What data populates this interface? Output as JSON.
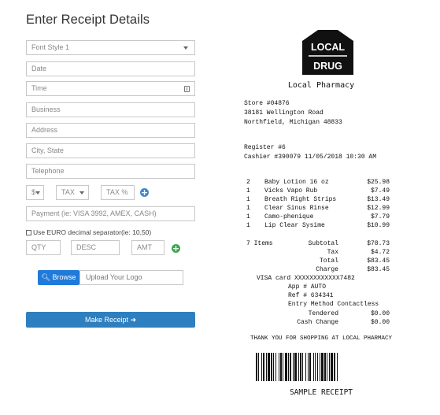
{
  "form": {
    "title": "Enter Receipt Details",
    "font_style": "Font Style 1",
    "date_placeholder": "Date",
    "time_placeholder": "Time",
    "business_placeholder": "Business",
    "address_placeholder": "Address",
    "city_state_placeholder": "City, State",
    "telephone_placeholder": "Telephone",
    "currency": "$",
    "tax_select": "TAX",
    "tax_percent_placeholder": "TAX %",
    "payment_placeholder": "Payment (ie: VISA 3992, AMEX, CASH)",
    "euro_checkbox_label": "Use EURO decimal separator(ie: 10,50)",
    "qty_placeholder": "QTY",
    "desc_placeholder": "DESC",
    "amt_placeholder": "AMT",
    "browse_label": "Browse",
    "upload_placeholder": "Upload Your Logo",
    "make_receipt_label": "Make Receipt"
  },
  "receipt": {
    "logo_lines": [
      "LOCAL",
      "DRUG"
    ],
    "store_name": "Local Pharmacy",
    "header_lines": [
      "Store #04876",
      "38181 Wellington Road",
      "Northfield, Michigan 48833"
    ],
    "register": "Register #6",
    "cashier": "Cashier #390079 11/05/2018 10:30 AM",
    "items": [
      {
        "qty": "2",
        "desc": "Baby Lotion 16 oz",
        "amt": "$25.98"
      },
      {
        "qty": "1",
        "desc": "Vicks Vapo Rub",
        "amt": "$7.49"
      },
      {
        "qty": "1",
        "desc": "Breath Right Strips",
        "amt": "$13.49"
      },
      {
        "qty": "1",
        "desc": "Clear Sinus Rinse",
        "amt": "$12.99"
      },
      {
        "qty": "1",
        "desc": "Camo-phenique",
        "amt": "$7.79"
      },
      {
        "qty": "1",
        "desc": "Lip Clear Sysime",
        "amt": "$10.99"
      }
    ],
    "items_count": "7 Items",
    "subtotal_label": "Subtotal",
    "subtotal": "$78.73",
    "tax_label": "Tax",
    "tax": "$4.72",
    "total_label": "Total",
    "total": "$83.45",
    "charge_label": "Charge",
    "charge": "$83.45",
    "card": "VISA card XXXXXXXXXXXX7482",
    "app": "App # AUTO",
    "ref": "Ref # 634341",
    "entry_method": "Entry Method Contactless",
    "tendered_label": "Tendered",
    "tendered": "$0.00",
    "change_label": "Cash Change",
    "change": "$0.00",
    "thanks": "THANK YOU FOR SHOPPING AT LOCAL PHARMACY",
    "sample_label": "SAMPLE RECEIPT"
  },
  "colors": {
    "browse_button": "#1f7ad9",
    "make_receipt_button": "#2e7fbf",
    "add_tax_icon": "#3a8ad8",
    "add_item_icon": "#3aa852"
  }
}
